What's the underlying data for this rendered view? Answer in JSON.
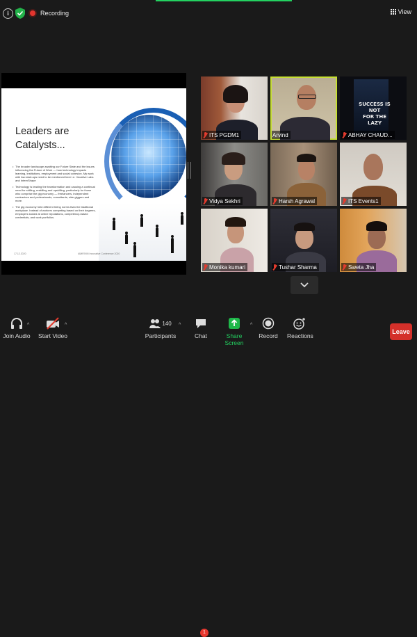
{
  "topbar": {
    "info_label": "i",
    "recording_label": "Recording",
    "view_label": "View"
  },
  "slide": {
    "title_line1": "Leaders are",
    "title_line2": "Catalysts...",
    "bullets": [
      "The broader landscape awaiting our Future State and the issues influencing the Future of Work — how technology impacts learning, institutions, employment and social cohesion. My work with two start-ups need to be mentioned here i.e. Vocative Labs and InternShape",
      "Technology is leading the transformation and causing a continual need for skilling, reskilling and upskilling, particularly for those who comprise the gig economy — freelancers, independent contractors and professionals, consultants, side giggers and more.",
      "The gig economy held different hiring norms than the traditional workplace. Instead of workers competing based on their degrees, employers looked at online reputations, competency-based credentials, and work portfolios."
    ],
    "footer_date": "17.12.2020",
    "footer_note": "IAMRIVIN Innovative Conference 2020"
  },
  "participants_tiles": [
    {
      "name": "ITS PGDM1",
      "muted": true,
      "active": false
    },
    {
      "name": "Arvind",
      "muted": false,
      "active": true
    },
    {
      "name": "ABHAY CHAUD...",
      "muted": true,
      "active": false
    },
    {
      "name": "Vidya Sekhri",
      "muted": true,
      "active": false
    },
    {
      "name": "Harsh Agrawal",
      "muted": true,
      "active": false
    },
    {
      "name": "ITS Events1",
      "muted": true,
      "active": false
    },
    {
      "name": "Monika kumari",
      "muted": true,
      "active": false
    },
    {
      "name": "Tushar Sharma",
      "muted": true,
      "active": false
    },
    {
      "name": "Sweta Jha",
      "muted": true,
      "active": false
    }
  ],
  "poster_text": {
    "line1": "SUCCESS IS NOT",
    "line2": "FOR THE LAZY"
  },
  "toolbar": {
    "join_audio": "Join Audio",
    "start_video": "Start Video",
    "participants": "Participants",
    "participants_count": "140",
    "chat": "Chat",
    "chat_badge": "1",
    "share_screen": "Share Screen",
    "record": "Record",
    "reactions": "Reactions",
    "leave": "Leave"
  },
  "colors": {
    "accent_green": "#23d160",
    "active_border": "#c6df33",
    "leave_red": "#d4302a",
    "share_green": "#1fb84a"
  }
}
